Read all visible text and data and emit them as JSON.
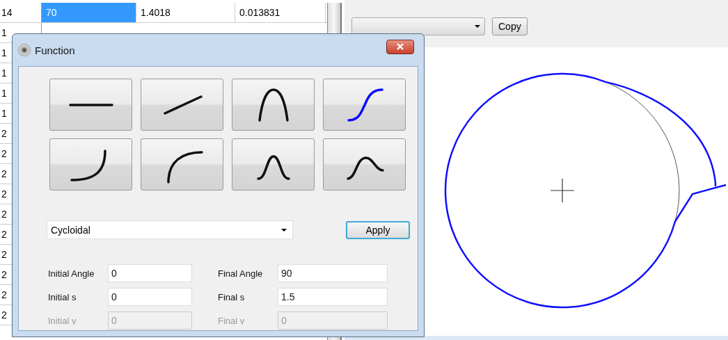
{
  "table": {
    "rows": [
      {
        "header": "14",
        "cells": [
          {
            "text": "70",
            "selected": true
          },
          {
            "text": "1.4018",
            "selected": false
          },
          {
            "text": "0.013831",
            "selected": false
          }
        ]
      },
      {
        "header": "1",
        "cells": []
      },
      {
        "header": "1",
        "cells": []
      },
      {
        "header": "1",
        "cells": []
      },
      {
        "header": "1",
        "cells": []
      },
      {
        "header": "1",
        "cells": []
      },
      {
        "header": "2",
        "cells": []
      },
      {
        "header": "2",
        "cells": []
      },
      {
        "header": "2",
        "cells": []
      },
      {
        "header": "2",
        "cells": []
      },
      {
        "header": "2",
        "cells": []
      },
      {
        "header": "2",
        "cells": []
      },
      {
        "header": "2",
        "cells": []
      },
      {
        "header": "2",
        "cells": []
      },
      {
        "header": "2",
        "cells": []
      },
      {
        "header": "2",
        "cells": []
      }
    ]
  },
  "toolbar": {
    "copy_button": "Copy"
  },
  "dialog": {
    "title": "Function",
    "functions": [
      {
        "kind": "constant",
        "selected": false
      },
      {
        "kind": "linear",
        "selected": false
      },
      {
        "kind": "parabola",
        "selected": false
      },
      {
        "kind": "s-curve",
        "selected": true
      },
      {
        "kind": "concave",
        "selected": false
      },
      {
        "kind": "convex",
        "selected": false
      },
      {
        "kind": "bell",
        "selected": false
      },
      {
        "kind": "skewed-bell",
        "selected": false
      }
    ],
    "profile": {
      "value": "Cycloidal"
    },
    "apply_button": "Apply",
    "fields": [
      {
        "label": "Initial Angle",
        "value": "0",
        "disabled": false
      },
      {
        "label": "Final Angle",
        "value": "90",
        "disabled": false
      },
      {
        "label": "Initial s",
        "value": "0",
        "disabled": false
      },
      {
        "label": "Final s",
        "value": "1.5",
        "disabled": false
      },
      {
        "label": "Initial v",
        "value": "0",
        "disabled": true
      },
      {
        "label": "Final v",
        "value": "0",
        "disabled": true
      }
    ]
  }
}
